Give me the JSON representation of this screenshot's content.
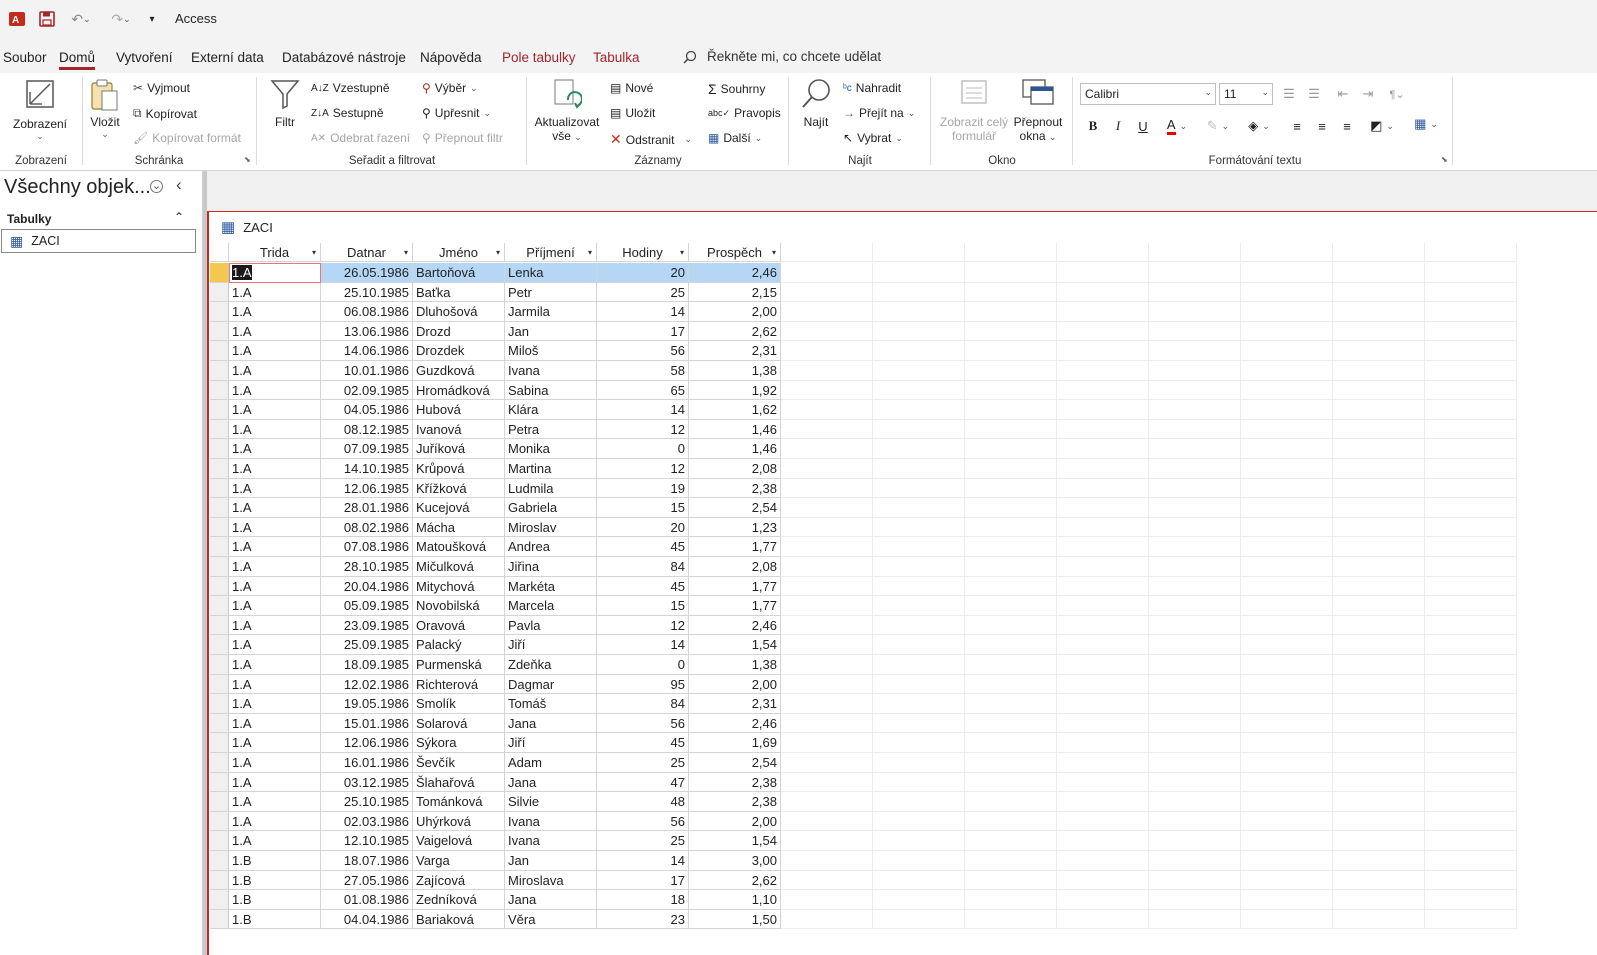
{
  "app": {
    "title": "Access"
  },
  "menu": {
    "tabs": [
      "Soubor",
      "Domů",
      "Vytvoření",
      "Externí data",
      "Databázové nástroje",
      "Nápověda",
      "Pole tabulky",
      "Tabulka"
    ],
    "tell_me": "Řekněte mi, co chcete udělat"
  },
  "ribbon": {
    "views": {
      "view": "Zobrazení",
      "group": "Zobrazení"
    },
    "clipboard": {
      "paste": "Vložit",
      "cut": "Vyjmout",
      "copy": "Kopírovat",
      "format_painter": "Kopírovat formát",
      "group": "Schránka"
    },
    "sortfilter": {
      "filter": "Filtr",
      "ascending": "Vzestupně",
      "descending": "Sestupně",
      "remove_sort": "Odebrat řazení",
      "selection": "Výběr",
      "advanced": "Upřesnit",
      "toggle_filter": "Přepnout filtr",
      "group": "Seřadit a filtrovat"
    },
    "records": {
      "refresh1": "Aktualizovat",
      "refresh2": "vše",
      "new": "Nové",
      "save": "Uložit",
      "delete": "Odstranit",
      "totals": "Souhrny",
      "spelling": "Pravopis",
      "more": "Další",
      "group": "Záznamy"
    },
    "find": {
      "find": "Najít",
      "replace": "Nahradit",
      "goto": "Přejít na",
      "select": "Vybrat",
      "group": "Najít"
    },
    "window": {
      "fit1": "Zobrazit celý",
      "fit2": "formulář",
      "switch1": "Přepnout",
      "switch2": "okna",
      "group": "Okno"
    },
    "text": {
      "font": "Calibri",
      "size": "11",
      "group": "Formátování textu"
    }
  },
  "nav": {
    "title": "Všechny objek...",
    "section": "Tabulky",
    "item": "ZACI"
  },
  "document": {
    "tab": "ZACI"
  },
  "table": {
    "columns": [
      "Trida",
      "Datnar",
      "Jméno",
      "Příjmení",
      "Hodiny",
      "Prospěch"
    ],
    "rows": [
      [
        "1.A",
        "26.05.1986",
        "Bartoňová",
        "Lenka",
        "20",
        "2,46"
      ],
      [
        "1.A",
        "25.10.1985",
        "Baťka",
        "Petr",
        "25",
        "2,15"
      ],
      [
        "1.A",
        "06.08.1986",
        "Dluhošová",
        "Jarmila",
        "14",
        "2,00"
      ],
      [
        "1.A",
        "13.06.1986",
        "Drozd",
        "Jan",
        "17",
        "2,62"
      ],
      [
        "1.A",
        "14.06.1986",
        "Drozdek",
        "Miloš",
        "56",
        "2,31"
      ],
      [
        "1.A",
        "10.01.1986",
        "Guzdková",
        "Ivana",
        "58",
        "1,38"
      ],
      [
        "1.A",
        "02.09.1985",
        "Hromádková",
        "Sabina",
        "65",
        "1,92"
      ],
      [
        "1.A",
        "04.05.1986",
        "Hubová",
        "Klára",
        "14",
        "1,62"
      ],
      [
        "1.A",
        "08.12.1985",
        "Ivanová",
        "Petra",
        "12",
        "1,46"
      ],
      [
        "1.A",
        "07.09.1985",
        "Juříková",
        "Monika",
        "0",
        "1,46"
      ],
      [
        "1.A",
        "14.10.1985",
        "Krůpová",
        "Martina",
        "12",
        "2,08"
      ],
      [
        "1.A",
        "12.06.1985",
        "Křížková",
        "Ludmila",
        "19",
        "2,38"
      ],
      [
        "1.A",
        "28.01.1986",
        "Kucejová",
        "Gabriela",
        "15",
        "2,54"
      ],
      [
        "1.A",
        "08.02.1986",
        "Mácha",
        "Miroslav",
        "20",
        "1,23"
      ],
      [
        "1.A",
        "07.08.1986",
        "Matoušková",
        "Andrea",
        "45",
        "1,77"
      ],
      [
        "1.A",
        "28.10.1985",
        "Mičulková",
        "Jiřina",
        "84",
        "2,08"
      ],
      [
        "1.A",
        "20.04.1986",
        "Mitychová",
        "Markéta",
        "45",
        "1,77"
      ],
      [
        "1.A",
        "05.09.1985",
        "Novobilská",
        "Marcela",
        "15",
        "1,77"
      ],
      [
        "1.A",
        "23.09.1985",
        "Oravová",
        "Pavla",
        "12",
        "2,46"
      ],
      [
        "1.A",
        "25.09.1985",
        "Palacký",
        "Jiří",
        "14",
        "1,54"
      ],
      [
        "1.A",
        "18.09.1985",
        "Purmenská",
        "Zdeňka",
        "0",
        "1,38"
      ],
      [
        "1.A",
        "12.02.1986",
        "Richterová",
        "Dagmar",
        "95",
        "2,00"
      ],
      [
        "1.A",
        "19.05.1986",
        "Smolík",
        "Tomáš",
        "84",
        "2,31"
      ],
      [
        "1.A",
        "15.01.1986",
        "Solarová",
        "Jana",
        "56",
        "2,46"
      ],
      [
        "1.A",
        "12.06.1986",
        "Sýkora",
        "Jiří",
        "45",
        "1,69"
      ],
      [
        "1.A",
        "16.01.1986",
        "Ševčík",
        "Adam",
        "25",
        "2,54"
      ],
      [
        "1.A",
        "03.12.1985",
        "Šlahařová",
        "Jana",
        "47",
        "2,38"
      ],
      [
        "1.A",
        "25.10.1985",
        "Tománková",
        "Silvie",
        "48",
        "2,38"
      ],
      [
        "1.A",
        "02.03.1986",
        "Uhýrková",
        "Ivana",
        "56",
        "2,00"
      ],
      [
        "1.A",
        "12.10.1985",
        "Vaigelová",
        "Ivana",
        "25",
        "1,54"
      ],
      [
        "1.B",
        "18.07.1986",
        "Varga",
        "Jan",
        "14",
        "3,00"
      ],
      [
        "1.B",
        "27.05.1986",
        "Zajícová",
        "Miroslava",
        "17",
        "2,62"
      ],
      [
        "1.B",
        "01.08.1986",
        "Zedníková",
        "Jana",
        "18",
        "1,10"
      ],
      [
        "1.B",
        "04.04.1986",
        "Bariaková",
        "Věra",
        "23",
        "1,50"
      ]
    ]
  },
  "colors": {
    "accent": "#a4262c",
    "selection": "#b5d7f5",
    "row_marker": "#f2c94c",
    "app_icon": "#c42b1c"
  }
}
